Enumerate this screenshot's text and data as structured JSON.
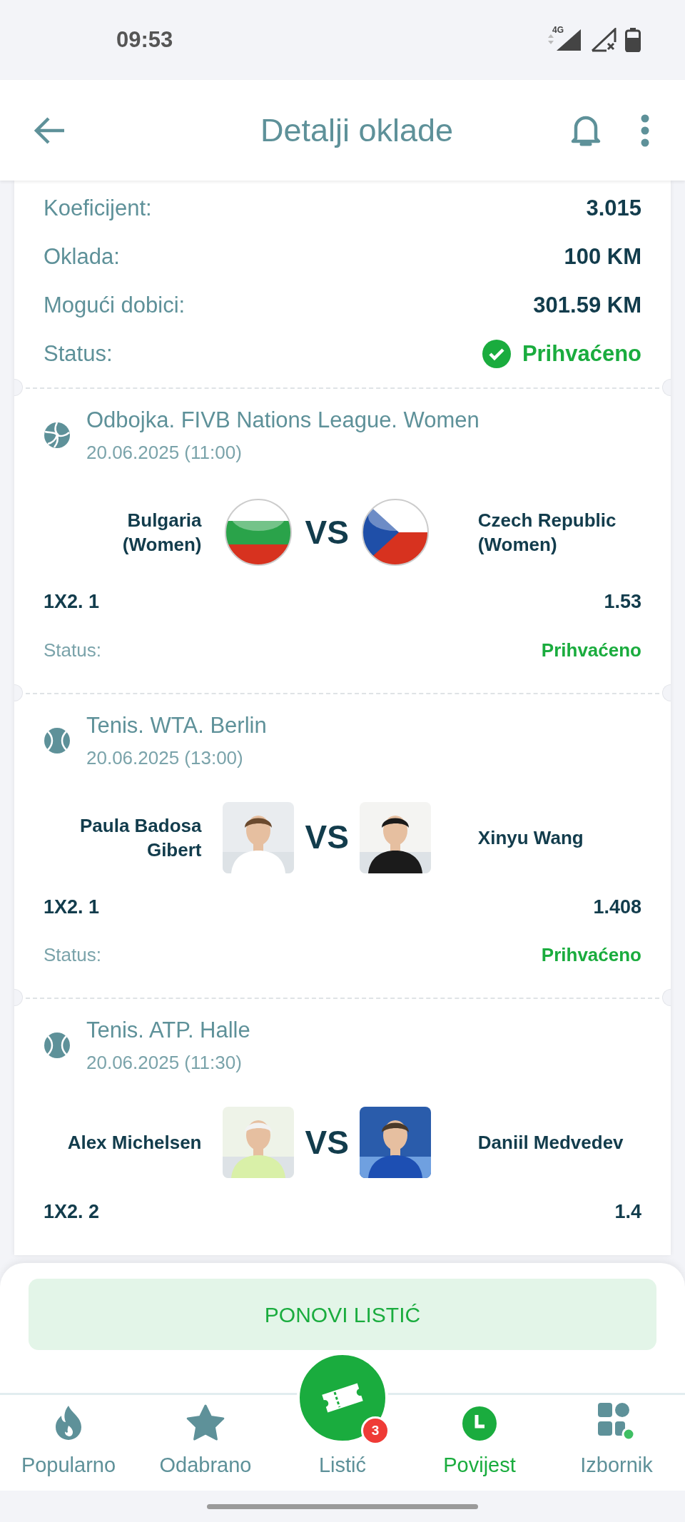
{
  "status_bar": {
    "time": "09:53",
    "network": "4G"
  },
  "header": {
    "title": "Detalji oklade"
  },
  "summary": [
    {
      "label": "Koeficijent:",
      "value": "3.015"
    },
    {
      "label": "Oklada:",
      "value": "100 KM"
    },
    {
      "label": "Mogući dobici:",
      "value": "301.59 KM"
    },
    {
      "label": "Status:",
      "value": "Prihvaćeno",
      "kind": "status"
    }
  ],
  "events": [
    {
      "kind": "volleyball",
      "title": "Odbojka. FIVB Nations League. Women",
      "date": "20.06.2025 (11:00)",
      "home": {
        "name": "Bulgaria (Women)",
        "kind": "tricolor_flag"
      },
      "vs": "VS",
      "away": {
        "name": "Czech Republic (Women)",
        "kind": "chevron_flag"
      },
      "pick": "1X2. 1",
      "odds": "1.53",
      "status_label": "Status:",
      "status": "Prihvaćeno"
    },
    {
      "kind": "tennis",
      "title": "Tenis. WTA. Berlin",
      "date": "20.06.2025 (13:00)",
      "home": {
        "name": "Paula Badosa Gibert",
        "kind": "picture"
      },
      "vs": "VS",
      "away": {
        "name": "Xinyu Wang",
        "kind": "picture"
      },
      "pick": "1X2. 1",
      "odds": "1.408",
      "status_label": "Status:",
      "status": "Prihvaćeno"
    },
    {
      "kind": "tennis",
      "title": "Tenis. ATP. Halle",
      "date": "20.06.2025 (11:30)",
      "home": {
        "name": "Alex Michelsen",
        "kind": "picture"
      },
      "vs": "VS",
      "away": {
        "name": "Daniil Medvedev",
        "kind": "picture"
      },
      "pick": "1X2. 2",
      "odds": "1.4"
    }
  ],
  "repeat_button": "PONOVI LISTIĆ",
  "nav": [
    {
      "kind": "flame",
      "label": "Popularno",
      "selected": false
    },
    {
      "kind": "star",
      "label": "Odabrano",
      "selected": false
    },
    {
      "kind": "ticket",
      "label": "Listić",
      "selected": false,
      "badge": "3"
    },
    {
      "kind": "clock",
      "label": "Povijest",
      "selected": true
    },
    {
      "kind": "grid",
      "label": "Izbornik",
      "selected": false
    }
  ]
}
